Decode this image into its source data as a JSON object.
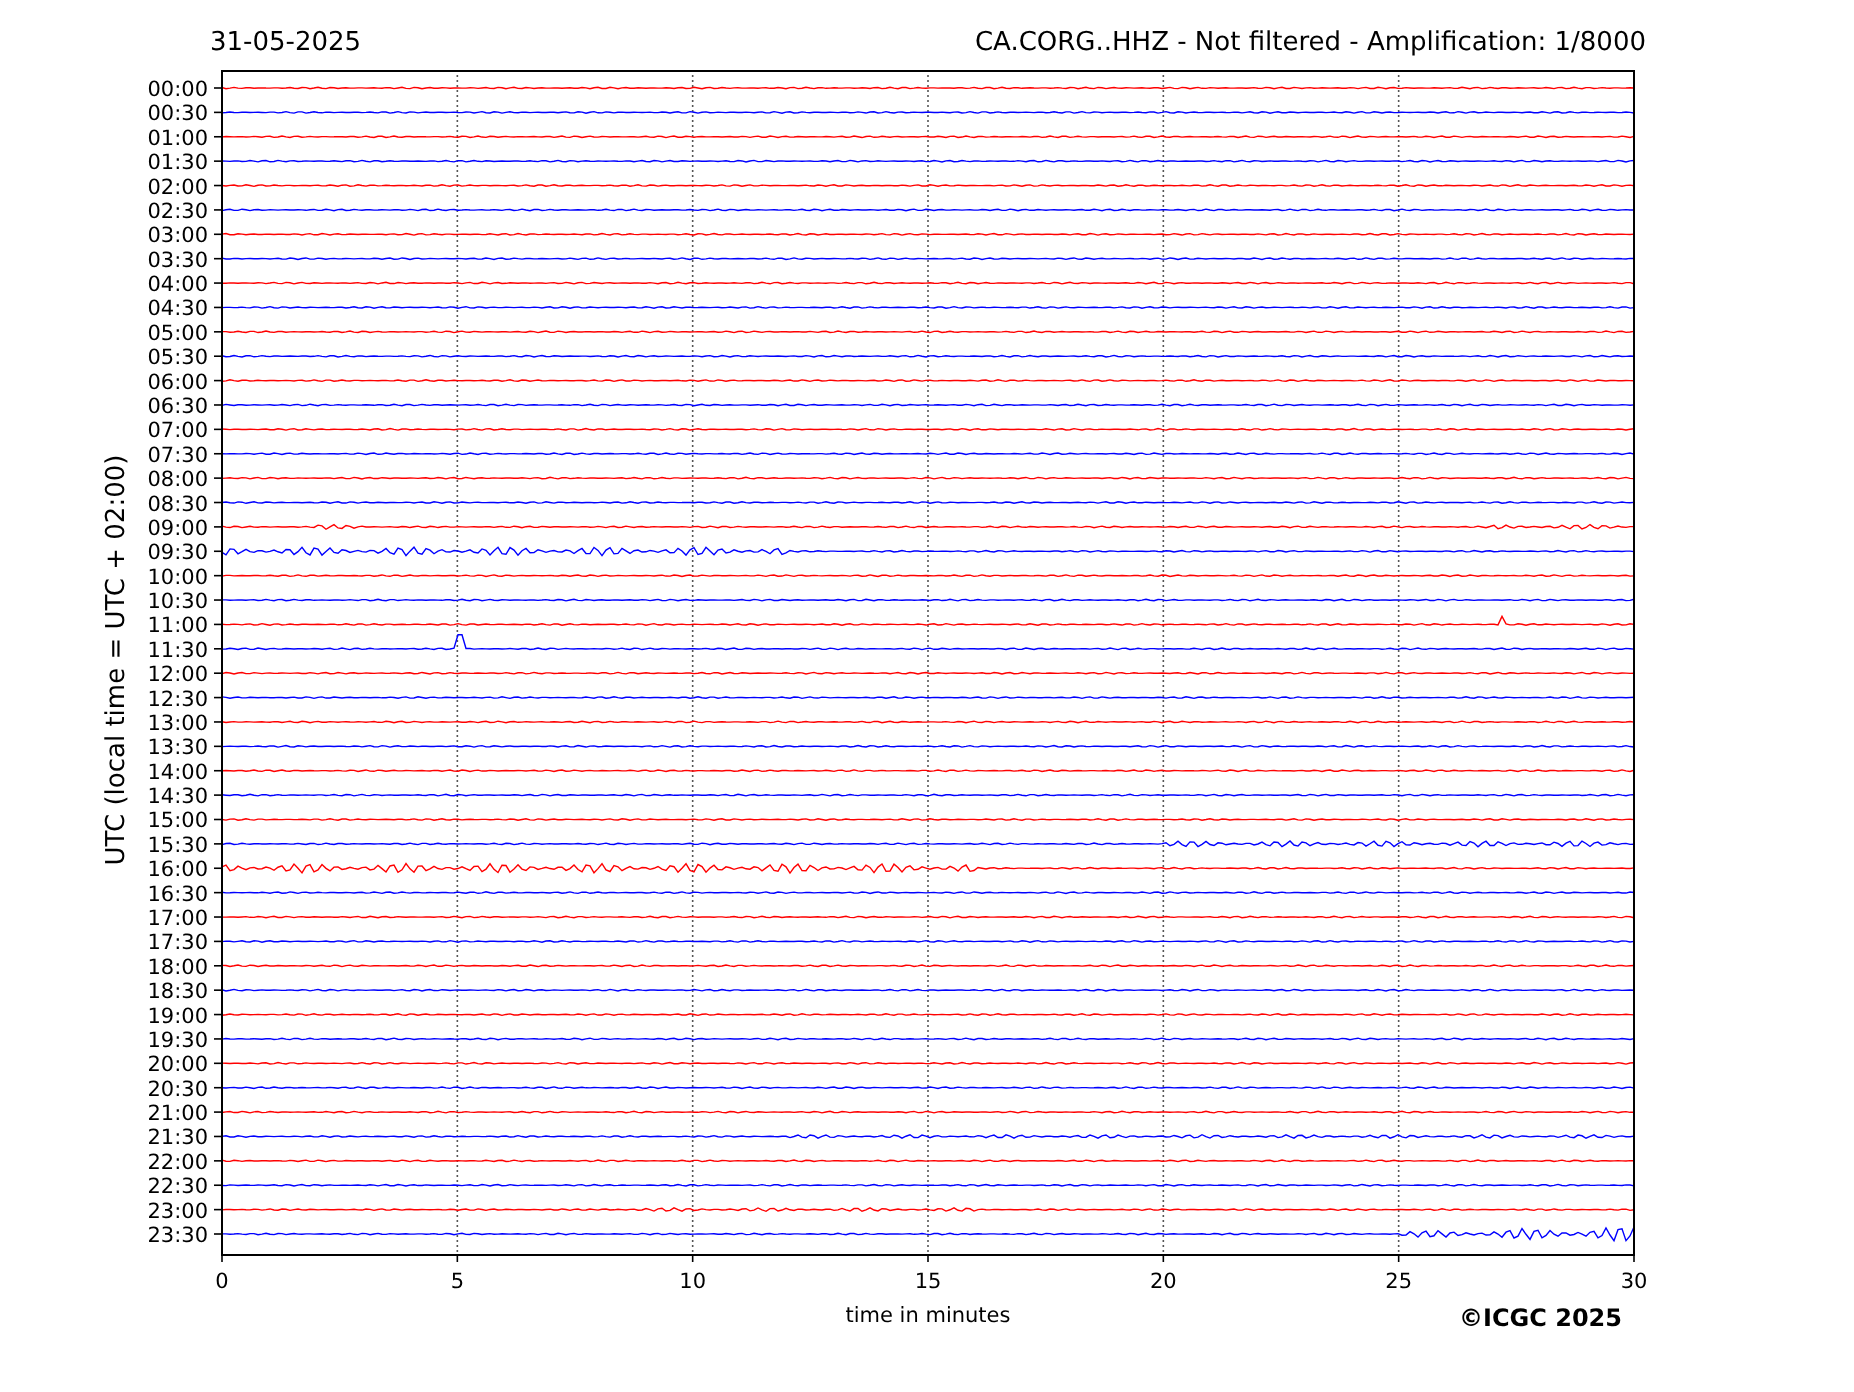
{
  "header": {
    "date": "31-05-2025",
    "title": "CA.CORG..HHZ - Not filtered - Amplification: 1/8000"
  },
  "plot": {
    "ylabel": "UTC (local time = UTC + 02:00)",
    "xlabel": "time in minutes",
    "copyright": "©ICGC 2025",
    "xticks": [
      "0",
      "5",
      "10",
      "15",
      "20",
      "25",
      "30"
    ],
    "rows": [
      {
        "label": "00:00",
        "color": "#ff0000"
      },
      {
        "label": "00:30",
        "color": "#0000ff"
      },
      {
        "label": "01:00",
        "color": "#ff0000"
      },
      {
        "label": "01:30",
        "color": "#0000ff"
      },
      {
        "label": "02:00",
        "color": "#ff0000"
      },
      {
        "label": "02:30",
        "color": "#0000ff"
      },
      {
        "label": "03:00",
        "color": "#ff0000"
      },
      {
        "label": "03:30",
        "color": "#0000ff"
      },
      {
        "label": "04:00",
        "color": "#ff0000"
      },
      {
        "label": "04:30",
        "color": "#0000ff"
      },
      {
        "label": "05:00",
        "color": "#ff0000"
      },
      {
        "label": "05:30",
        "color": "#0000ff"
      },
      {
        "label": "06:00",
        "color": "#ff0000"
      },
      {
        "label": "06:30",
        "color": "#0000ff"
      },
      {
        "label": "07:00",
        "color": "#ff0000"
      },
      {
        "label": "07:30",
        "color": "#0000ff"
      },
      {
        "label": "08:00",
        "color": "#ff0000"
      },
      {
        "label": "08:30",
        "color": "#0000ff"
      },
      {
        "label": "09:00",
        "color": "#ff0000"
      },
      {
        "label": "09:30",
        "color": "#0000ff"
      },
      {
        "label": "10:00",
        "color": "#ff0000"
      },
      {
        "label": "10:30",
        "color": "#0000ff"
      },
      {
        "label": "11:00",
        "color": "#ff0000"
      },
      {
        "label": "11:30",
        "color": "#0000ff"
      },
      {
        "label": "12:00",
        "color": "#ff0000"
      },
      {
        "label": "12:30",
        "color": "#0000ff"
      },
      {
        "label": "13:00",
        "color": "#ff0000"
      },
      {
        "label": "13:30",
        "color": "#0000ff"
      },
      {
        "label": "14:00",
        "color": "#ff0000"
      },
      {
        "label": "14:30",
        "color": "#0000ff"
      },
      {
        "label": "15:00",
        "color": "#ff0000"
      },
      {
        "label": "15:30",
        "color": "#0000ff"
      },
      {
        "label": "16:00",
        "color": "#ff0000"
      },
      {
        "label": "16:30",
        "color": "#0000ff"
      },
      {
        "label": "17:00",
        "color": "#ff0000"
      },
      {
        "label": "17:30",
        "color": "#0000ff"
      },
      {
        "label": "18:00",
        "color": "#ff0000"
      },
      {
        "label": "18:30",
        "color": "#0000ff"
      },
      {
        "label": "19:00",
        "color": "#ff0000"
      },
      {
        "label": "19:30",
        "color": "#0000ff"
      },
      {
        "label": "20:00",
        "color": "#ff0000"
      },
      {
        "label": "20:30",
        "color": "#0000ff"
      },
      {
        "label": "21:00",
        "color": "#ff0000"
      },
      {
        "label": "21:30",
        "color": "#0000ff"
      },
      {
        "label": "22:00",
        "color": "#ff0000"
      },
      {
        "label": "22:30",
        "color": "#0000ff"
      },
      {
        "label": "23:00",
        "color": "#ff0000"
      },
      {
        "label": "23:30",
        "color": "#0000ff"
      }
    ]
  }
}
